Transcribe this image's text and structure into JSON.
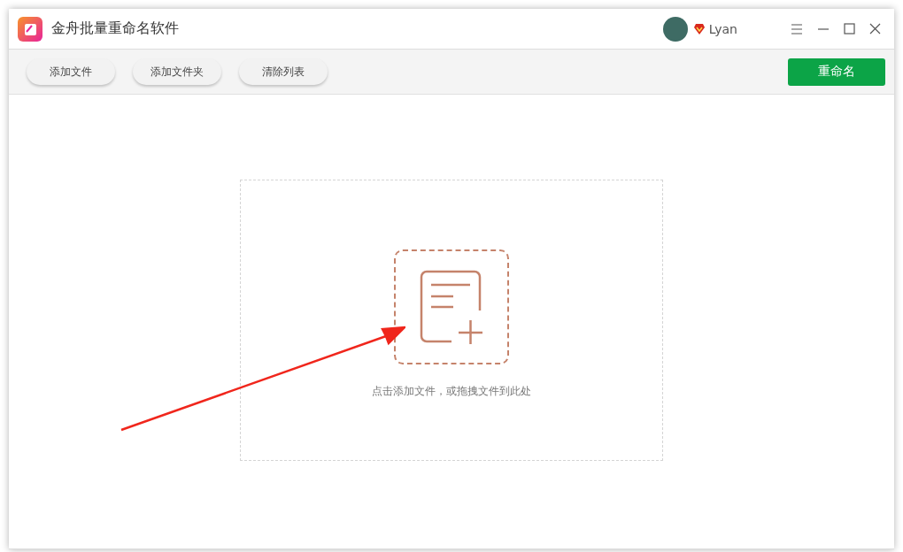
{
  "window": {
    "title": "金舟批量重命名软件",
    "user": "Lyan"
  },
  "toolbar": {
    "buttons": [
      "添加文件",
      "添加文件夹",
      "清除列表"
    ],
    "primary": "重命名"
  },
  "drop_zone": {
    "hint": "点击添加文件，或拖拽文件到此处"
  }
}
